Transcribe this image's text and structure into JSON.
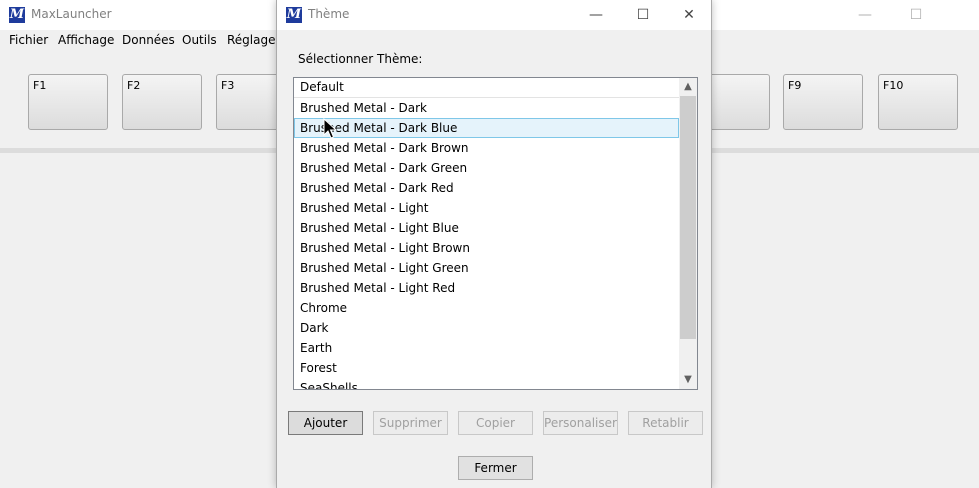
{
  "main_window": {
    "title": "MaxLauncher",
    "app_icon": "M",
    "controls": {
      "minimize": "—",
      "maximize": "☐"
    },
    "menu": [
      "Fichier",
      "Affichage",
      "Données",
      "Outils",
      "Réglages"
    ],
    "function_keys": [
      "F1",
      "F2",
      "F3",
      "F9",
      "F10"
    ]
  },
  "dialog": {
    "title": "Thème",
    "app_icon": "M",
    "controls": {
      "minimize": "—",
      "maximize": "☐",
      "close": "✕"
    },
    "select_label": "Sélectionner Thème:",
    "list_header": "Default",
    "themes": [
      "Brushed Metal - Dark",
      "Brushed Metal - Dark Blue",
      "Brushed Metal - Dark Brown",
      "Brushed Metal - Dark Green",
      "Brushed Metal - Dark Red",
      "Brushed Metal - Light",
      "Brushed Metal - Light Blue",
      "Brushed Metal - Light Brown",
      "Brushed Metal - Light Green",
      "Brushed Metal - Light Red",
      "Chrome",
      "Dark",
      "Earth",
      "Forest",
      "SeaShells"
    ],
    "selected_theme": "Brushed Metal - Dark Blue",
    "buttons": {
      "add": "Ajouter",
      "delete": "Supprimer",
      "copy": "Copier",
      "customize": "Personaliser",
      "restore": "Retablir",
      "close": "Fermer"
    },
    "scrollbar": {
      "up_icon": "chevron-up-icon",
      "down_icon": "chevron-down-icon"
    }
  },
  "colors": {
    "selection_bg": "#e5f3fb",
    "selection_border": "#7fc7e8",
    "icon_bg": "#1e3b9c"
  }
}
